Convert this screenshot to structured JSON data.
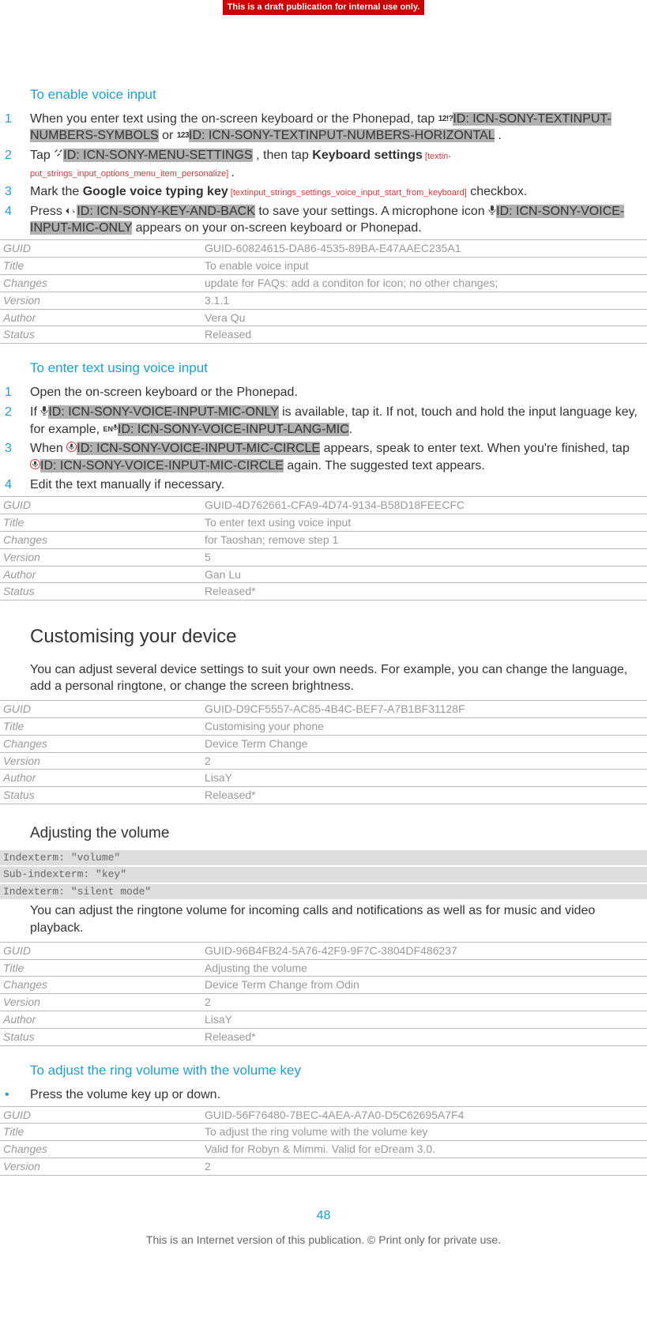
{
  "draft_banner": "This is a draft publication for internal use only.",
  "section1": {
    "heading": "To enable voice input",
    "steps": [
      {
        "num": "1",
        "pre": "When you enter text using the on-screen keyboard or the Phonepad, tap ",
        "icon1_txt": "12!?",
        "id1": "ID: ICN-SONY-TEXTINPUT-NUMBERS-SYMBOLS",
        "or": " or ",
        "icon2_txt": "123",
        "id2": "ID: ICN-SONY-TEXTINPUT-NUMBERS-HORIZONTAL",
        "post": " ."
      },
      {
        "num": "2",
        "pre": "Tap ",
        "id1": "ID: ICN-SONY-MENU-SETTINGS",
        "mid": " , then tap ",
        "bold": "Keyboard settings",
        "ph": " [textin-put_strings_input_options_menu_item_personalize] ",
        "post": "."
      },
      {
        "num": "3",
        "pre": "Mark the ",
        "bold": "Google voice typing key",
        "ph": " [textinput_strings_settings_voice_input_start_from_keyboard]",
        "post": " checkbox."
      },
      {
        "num": "4",
        "pre": "Press ",
        "id1": "ID: ICN-SONY-KEY-AND-BACK",
        "mid": " to save your settings. A microphone icon ",
        "id2": "ID: ICN-SONY-VOICE-INPUT-MIC-ONLY",
        "post": " appears on your on-screen keyboard or Phonepad."
      }
    ],
    "meta": {
      "GUID": "GUID-60824615-DA86-4535-89BA-E47AAEC235A1",
      "Title": "To enable voice input",
      "Changes": "update for FAQs: add a conditon for icon; no other changes;",
      "Version": "3.1.1",
      "Author": "Vera Qu",
      "Status": "Released"
    }
  },
  "section2": {
    "heading": "To enter text using voice input",
    "steps": [
      {
        "num": "1",
        "text": "Open the on-screen keyboard or the Phonepad."
      },
      {
        "num": "2",
        "pre": "If ",
        "id1": "ID: ICN-SONY-VOICE-INPUT-MIC-ONLY",
        "mid": " is available, tap it. If not, touch and hold the input language key, for example, ",
        "icon2_txt": "EN",
        "id2": "ID: ICN-SONY-VOICE-INPUT-LANG-MIC",
        "post": "."
      },
      {
        "num": "3",
        "pre": "When ",
        "id1": "ID: ICN-SONY-VOICE-INPUT-MIC-CIRCLE",
        "mid": " appears, speak to enter text. When you're finished, tap ",
        "id2": "ID: ICN-SONY-VOICE-INPUT-MIC-CIRCLE",
        "post": " again. The suggested text appears."
      },
      {
        "num": "4",
        "text": "Edit the text manually if necessary."
      }
    ],
    "meta": {
      "GUID": "GUID-4D762661-CFA9-4D74-9134-B58D18FEECFC",
      "Title": "To enter text using voice input",
      "Changes": "for Taoshan; remove step 1",
      "Version": "5",
      "Author": "Gan Lu",
      "Status": "Released*"
    }
  },
  "section3": {
    "heading": "Customising your device",
    "para": "You can adjust several device settings to suit your own needs. For example, you can change the language, add a personal ringtone, or change the screen brightness.",
    "meta": {
      "GUID": "GUID-D9CF5557-AC85-4B4C-BEF7-A7B1BF31128F",
      "Title": "Customising your phone",
      "Changes": "Device Term Change",
      "Version": "2",
      "Author": "LisaY",
      "Status": "Released*"
    }
  },
  "section4": {
    "heading": "Adjusting the volume",
    "indexterms": [
      "Indexterm: \"volume\"",
      "Sub-indexterm: \"key\"",
      "Indexterm: \"silent mode\""
    ],
    "para": "You can adjust the ringtone volume for incoming calls and notifications as well as for music and video playback.",
    "meta": {
      "GUID": "GUID-96B4FB24-5A76-42F9-9F7C-3804DF486237",
      "Title": "Adjusting the volume",
      "Changes": "Device Term Change from Odin",
      "Version": "2",
      "Author": "LisaY",
      "Status": "Released*"
    }
  },
  "section5": {
    "heading": "To adjust the ring volume with the volume key",
    "bullet": "Press the volume key up or down.",
    "meta": {
      "GUID": "GUID-56F76480-7BEC-4AEA-A7A0-D5C62695A7F4",
      "Title": "To adjust the ring volume with the volume key",
      "Changes": "Valid for Robyn & Mimmi. Valid for eDream 3.0.",
      "Version": "2"
    }
  },
  "page_number": "48",
  "footer": "This is an Internet version of this publication. © Print only for private use.",
  "meta_labels": {
    "GUID": "GUID",
    "Title": "Title",
    "Changes": "Changes",
    "Version": "Version",
    "Author": "Author",
    "Status": "Status"
  }
}
